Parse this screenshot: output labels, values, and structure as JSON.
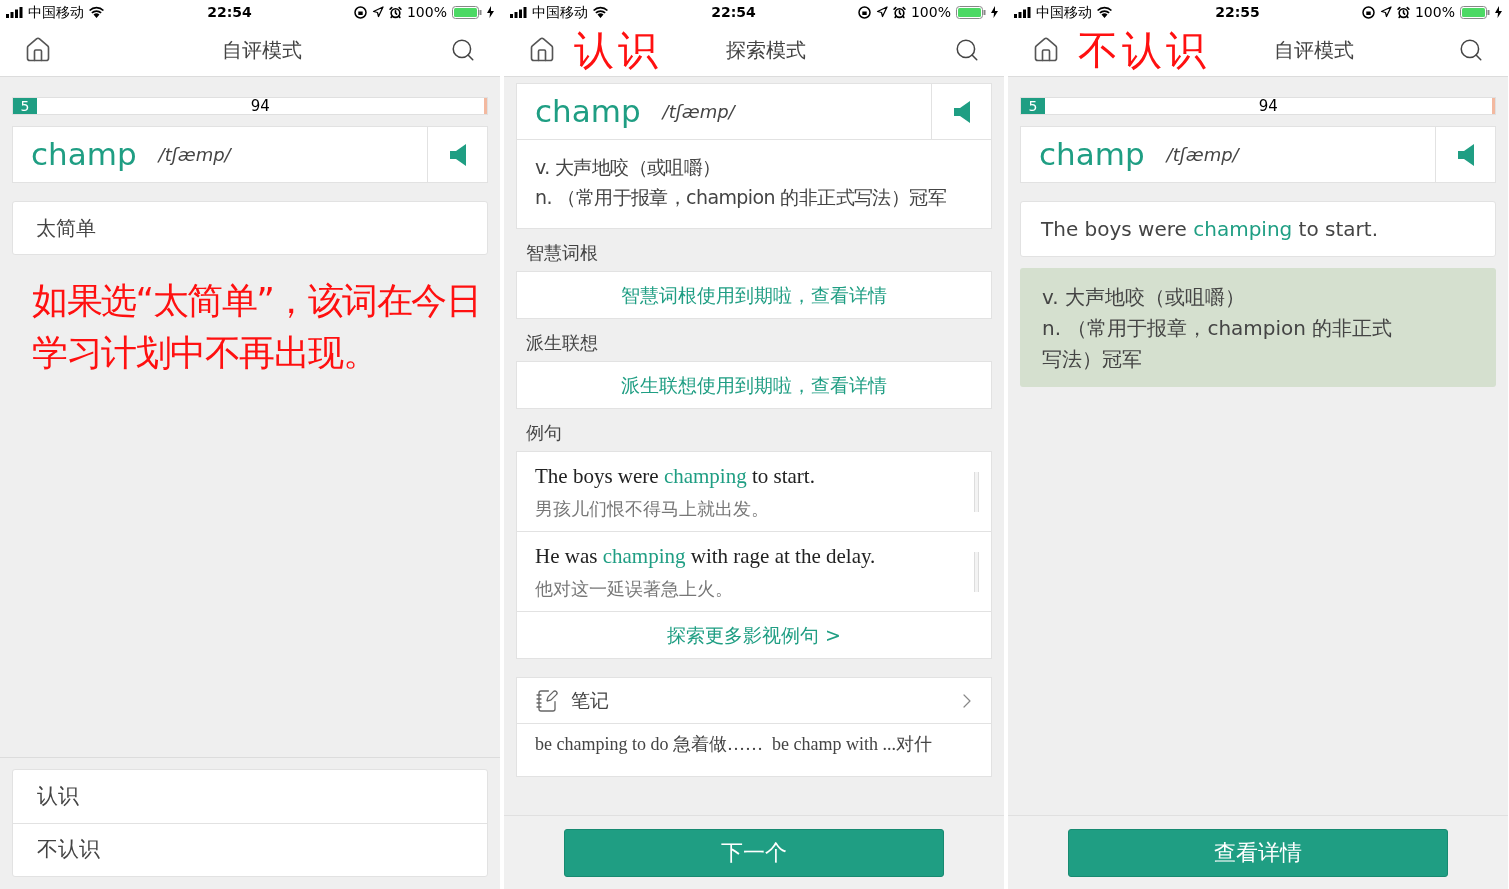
{
  "screens": [
    {
      "status_bar": {
        "carrier": "中国移动",
        "time": "22:54",
        "battery": "100%"
      },
      "nav": {
        "title": "自评模式"
      },
      "blocks": [
        {
          "kind": "progress",
          "badge": "5",
          "count": "94",
          "level": 0.05
        },
        {
          "kind": "word",
          "word": "champ",
          "phonetic": "/tʃæmp/"
        },
        {
          "kind": "option",
          "label": "太简单"
        },
        {
          "kind": "annotation",
          "text": "如果选“太简单”，该词在今日学习计划中不再出现。"
        }
      ],
      "footer": {
        "kind": "options",
        "items": [
          "认识",
          "不认识"
        ]
      }
    },
    {
      "status_bar": {
        "carrier": "中国移动",
        "time": "22:54",
        "battery": "100%"
      },
      "nav": {
        "annotation": "认识",
        "title": "探索模式"
      },
      "blocks": [
        {
          "kind": "word_definition",
          "word": "champ",
          "phonetic": "/tʃæmp/",
          "lines": [
            "v. 大声地咬（或咀嚼）",
            "n. （常用于报章，champion 的非正式写法）冠军"
          ]
        },
        {
          "kind": "section",
          "title": "智慧词根",
          "link": "智慧词根使用到期啦，查看详情"
        },
        {
          "kind": "section",
          "title": "派生联想",
          "link": "派生联想使用到期啦，查看详情"
        },
        {
          "kind": "examples",
          "title": "例句",
          "more": "探索更多影视例句 >",
          "items": [
            {
              "before": "The boys were ",
              "highlight": "champing",
              "after": " to start.",
              "translation": "男孩儿们恨不得马上就出发。"
            },
            {
              "before": "He was ",
              "highlight": "champing",
              "after": " with rage at the delay.",
              "translation": "他对这一延误著急上火。"
            }
          ]
        },
        {
          "kind": "notes",
          "title": "笔记",
          "text": "be champing to do 急着做……  be champ with ...对什"
        }
      ],
      "footer": {
        "kind": "button",
        "label": "下一个"
      }
    },
    {
      "status_bar": {
        "carrier": "中国移动",
        "time": "22:55",
        "battery": "100%"
      },
      "nav": {
        "annotation": "不认识",
        "title": "自评模式"
      },
      "blocks": [
        {
          "kind": "progress",
          "badge": "5",
          "count": "94",
          "level": 0.05
        },
        {
          "kind": "word",
          "word": "champ",
          "phonetic": "/tʃæmp/"
        },
        {
          "kind": "sentence",
          "before": "The boys were ",
          "highlight": "champing",
          "after": " to start."
        },
        {
          "kind": "definition",
          "lines": [
            "v. 大声地咬（或咀嚼）",
            "n. （常用于报章，champion 的非正式写法）冠军"
          ]
        }
      ],
      "footer": {
        "kind": "button",
        "label": "查看详情"
      }
    }
  ]
}
